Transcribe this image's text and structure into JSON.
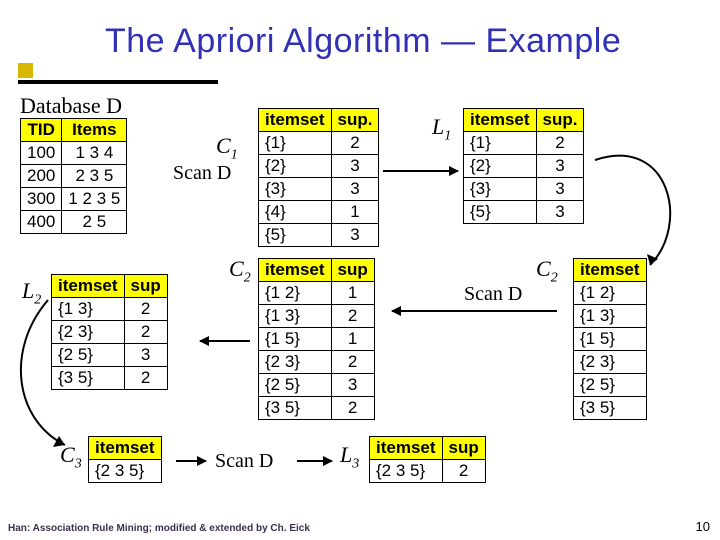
{
  "title": "The Apriori Algorithm — Example",
  "labels": {
    "databaseD": "Database D",
    "C1": "C",
    "C1sub": "1",
    "L1": "L",
    "L1sub": "1",
    "C2a": "C",
    "C2asub": "2",
    "C2b": "C",
    "C2bsub": "2",
    "L2": "L",
    "L2sub": "2",
    "C3": "C",
    "C3sub": "3",
    "L3": "L",
    "L3sub": "3",
    "scanD1": "Scan D",
    "scanD2": "Scan D",
    "scanD3": "Scan D"
  },
  "tables": {
    "D": {
      "headers": [
        "TID",
        "Items"
      ],
      "rows": [
        [
          "100",
          "1 3 4"
        ],
        [
          "200",
          "2 3 5"
        ],
        [
          "300",
          "1 2 3 5"
        ],
        [
          "400",
          "2 5"
        ]
      ]
    },
    "C1": {
      "headers": [
        "itemset",
        "sup."
      ],
      "rows": [
        [
          "{1}",
          "2"
        ],
        [
          "{2}",
          "3"
        ],
        [
          "{3}",
          "3"
        ],
        [
          "{4}",
          "1"
        ],
        [
          "{5}",
          "3"
        ]
      ]
    },
    "L1": {
      "headers": [
        "itemset",
        "sup."
      ],
      "rows": [
        [
          "{1}",
          "2"
        ],
        [
          "{2}",
          "3"
        ],
        [
          "{3}",
          "3"
        ],
        [
          "{5}",
          "3"
        ]
      ]
    },
    "C2b": {
      "headers": [
        "itemset"
      ],
      "rows": [
        [
          "{1 2}"
        ],
        [
          "{1 3}"
        ],
        [
          "{1 5}"
        ],
        [
          "{2 3}"
        ],
        [
          "{2 5}"
        ],
        [
          "{3 5}"
        ]
      ]
    },
    "C2a": {
      "headers": [
        "itemset",
        "sup"
      ],
      "rows": [
        [
          "{1 2}",
          "1"
        ],
        [
          "{1 3}",
          "2"
        ],
        [
          "{1 5}",
          "1"
        ],
        [
          "{2 3}",
          "2"
        ],
        [
          "{2 5}",
          "3"
        ],
        [
          "{3 5}",
          "2"
        ]
      ]
    },
    "L2": {
      "headers": [
        "itemset",
        "sup"
      ],
      "rows": [
        [
          "{1 3}",
          "2"
        ],
        [
          "{2 3}",
          "2"
        ],
        [
          "{2 5}",
          "3"
        ],
        [
          "{3 5}",
          "2"
        ]
      ]
    },
    "C3": {
      "headers": [
        "itemset"
      ],
      "rows": [
        [
          "{2 3 5}"
        ]
      ]
    },
    "L3": {
      "headers": [
        "itemset",
        "sup"
      ],
      "rows": [
        [
          "{2 3 5}",
          "2"
        ]
      ]
    }
  },
  "footer": "Han: Association Rule Mining; modified & extended by Ch. Eick",
  "pagenum": "10"
}
